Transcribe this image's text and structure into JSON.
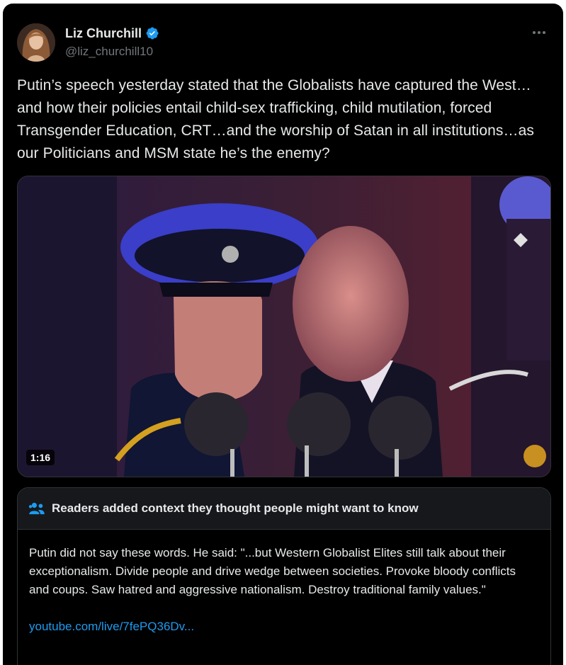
{
  "author": {
    "name": "Liz Churchill",
    "handle": "@liz_churchill10"
  },
  "tweet": {
    "text": "Putin’s speech yesterday stated that the Globalists have captured the West…and how their policies entail child-sex trafficking, child mutilation, forced Transgender Education, CRT…and the worship of Satan in all institutions…as our Politicians and MSM state he’s the enemy?"
  },
  "video": {
    "duration": "1:16"
  },
  "community_note": {
    "title": "Readers added context they thought people might want to know",
    "body": "Putin did not say these words. He said: \"...but Western Globalist Elites still talk about their exceptionalism. Divide people and drive wedge between societies. Provoke bloody conflicts and coups. Saw hatred and aggressive nationalism. Destroy traditional family values.\"",
    "link": "youtube.com/live/7fePQ36Dv..."
  },
  "icons": {
    "verified": "verified-badge-icon",
    "more": "more-options-icon",
    "notes": "people-icon"
  },
  "colors": {
    "background": "#000000",
    "text": "#e7e9ea",
    "secondary": "#71767b",
    "accent": "#1d9bf0"
  }
}
